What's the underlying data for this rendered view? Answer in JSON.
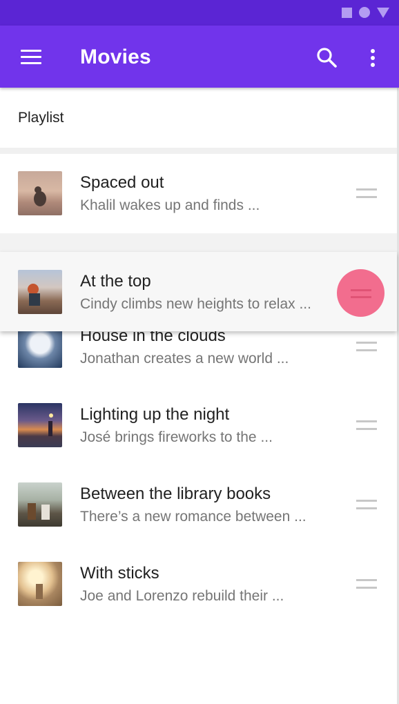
{
  "status_bar": {
    "icons": [
      "square-icon",
      "circle-icon",
      "triangle-icon"
    ],
    "background": "#5b25d4"
  },
  "app_bar": {
    "title": "Movies",
    "menu_icon": "menu-icon",
    "search_icon": "search-icon",
    "more_icon": "more-vert-icon",
    "background": "#7134eb"
  },
  "section": {
    "label": "Playlist"
  },
  "list": {
    "items": [
      {
        "title": "Spaced out",
        "subtitle": "Khalil wakes up and finds ..."
      },
      {
        "title": "At the top",
        "subtitle": "Cindy climbs new heights to relax ..."
      },
      {
        "title": "House in the clouds",
        "subtitle": "Jonathan creates a new world ..."
      },
      {
        "title": "Lighting up the night",
        "subtitle": "José brings fireworks to the ..."
      },
      {
        "title": "Between the library books",
        "subtitle": "There’s a new romance between ..."
      },
      {
        "title": "With sticks",
        "subtitle": "Joe and Lorenzo rebuild their ..."
      }
    ],
    "dragging_index": 1,
    "drag_ripple_color": "#f26d8e"
  }
}
